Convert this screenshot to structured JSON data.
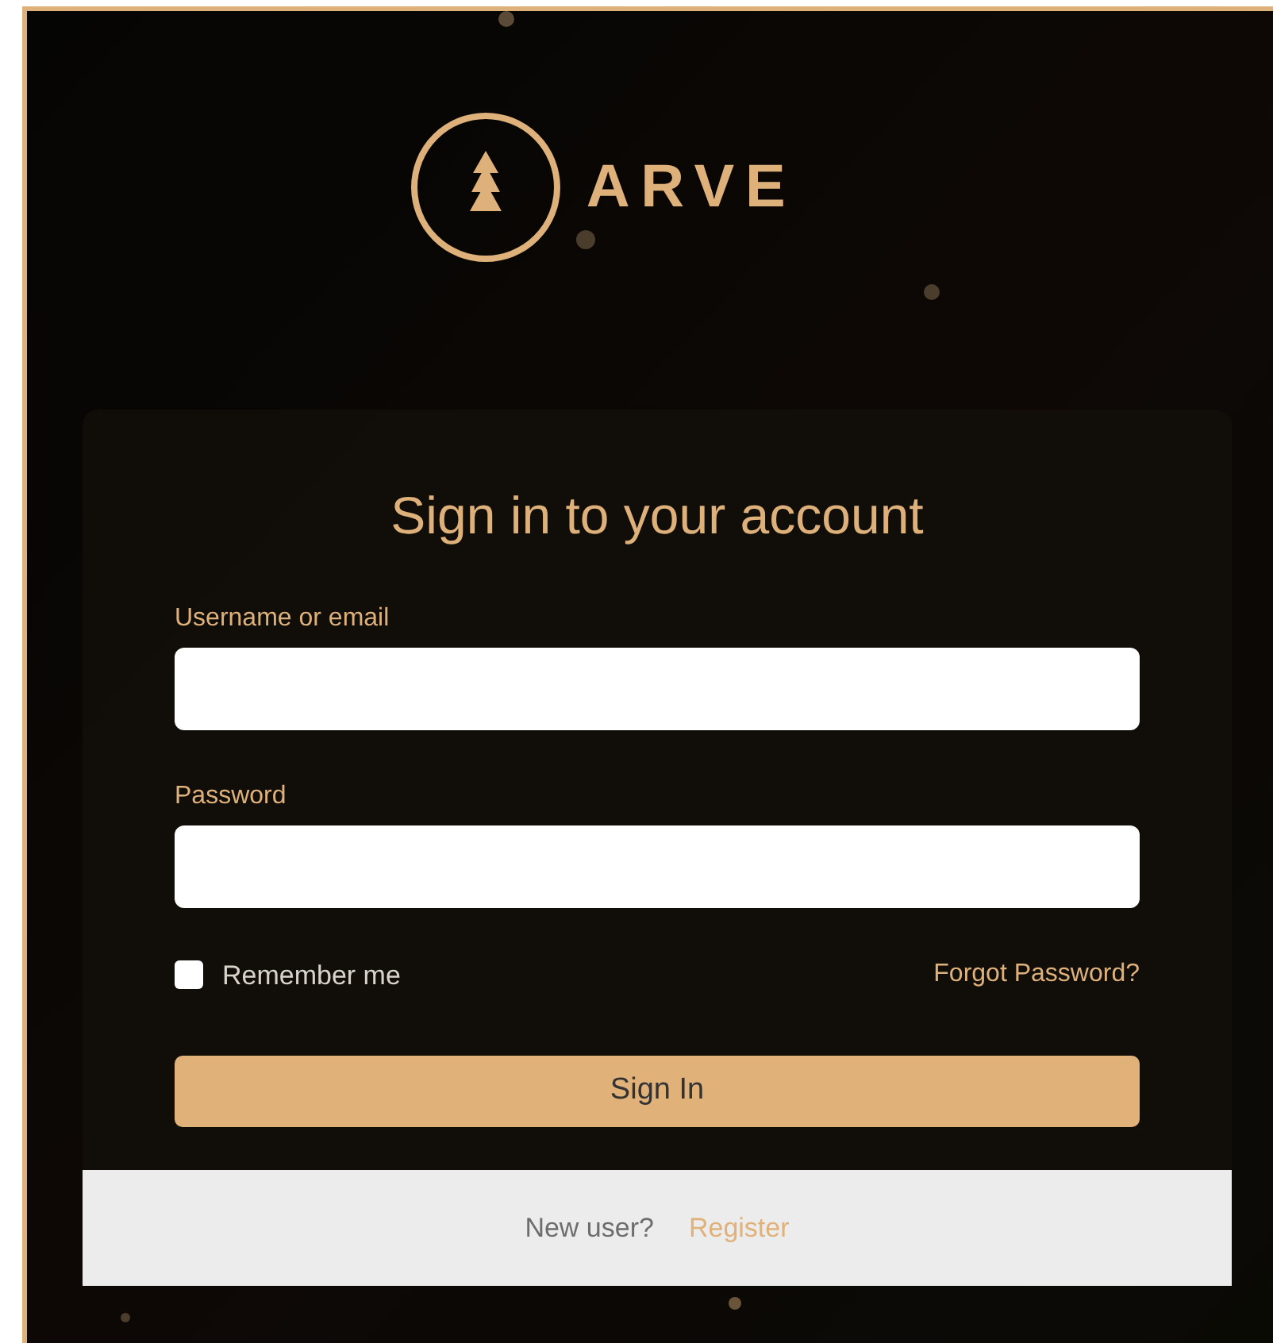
{
  "logo": {
    "text": "ARVE"
  },
  "form": {
    "title": "Sign in to your account",
    "fields": [
      {
        "label": "Username or email"
      },
      {
        "label": "Password"
      }
    ],
    "remember": {
      "label": "Remember me",
      "checked": false
    },
    "forgot_link": "Forgot Password?",
    "submit": "Sign In"
  },
  "footer": {
    "prompt": "New user?",
    "link": "Register"
  }
}
